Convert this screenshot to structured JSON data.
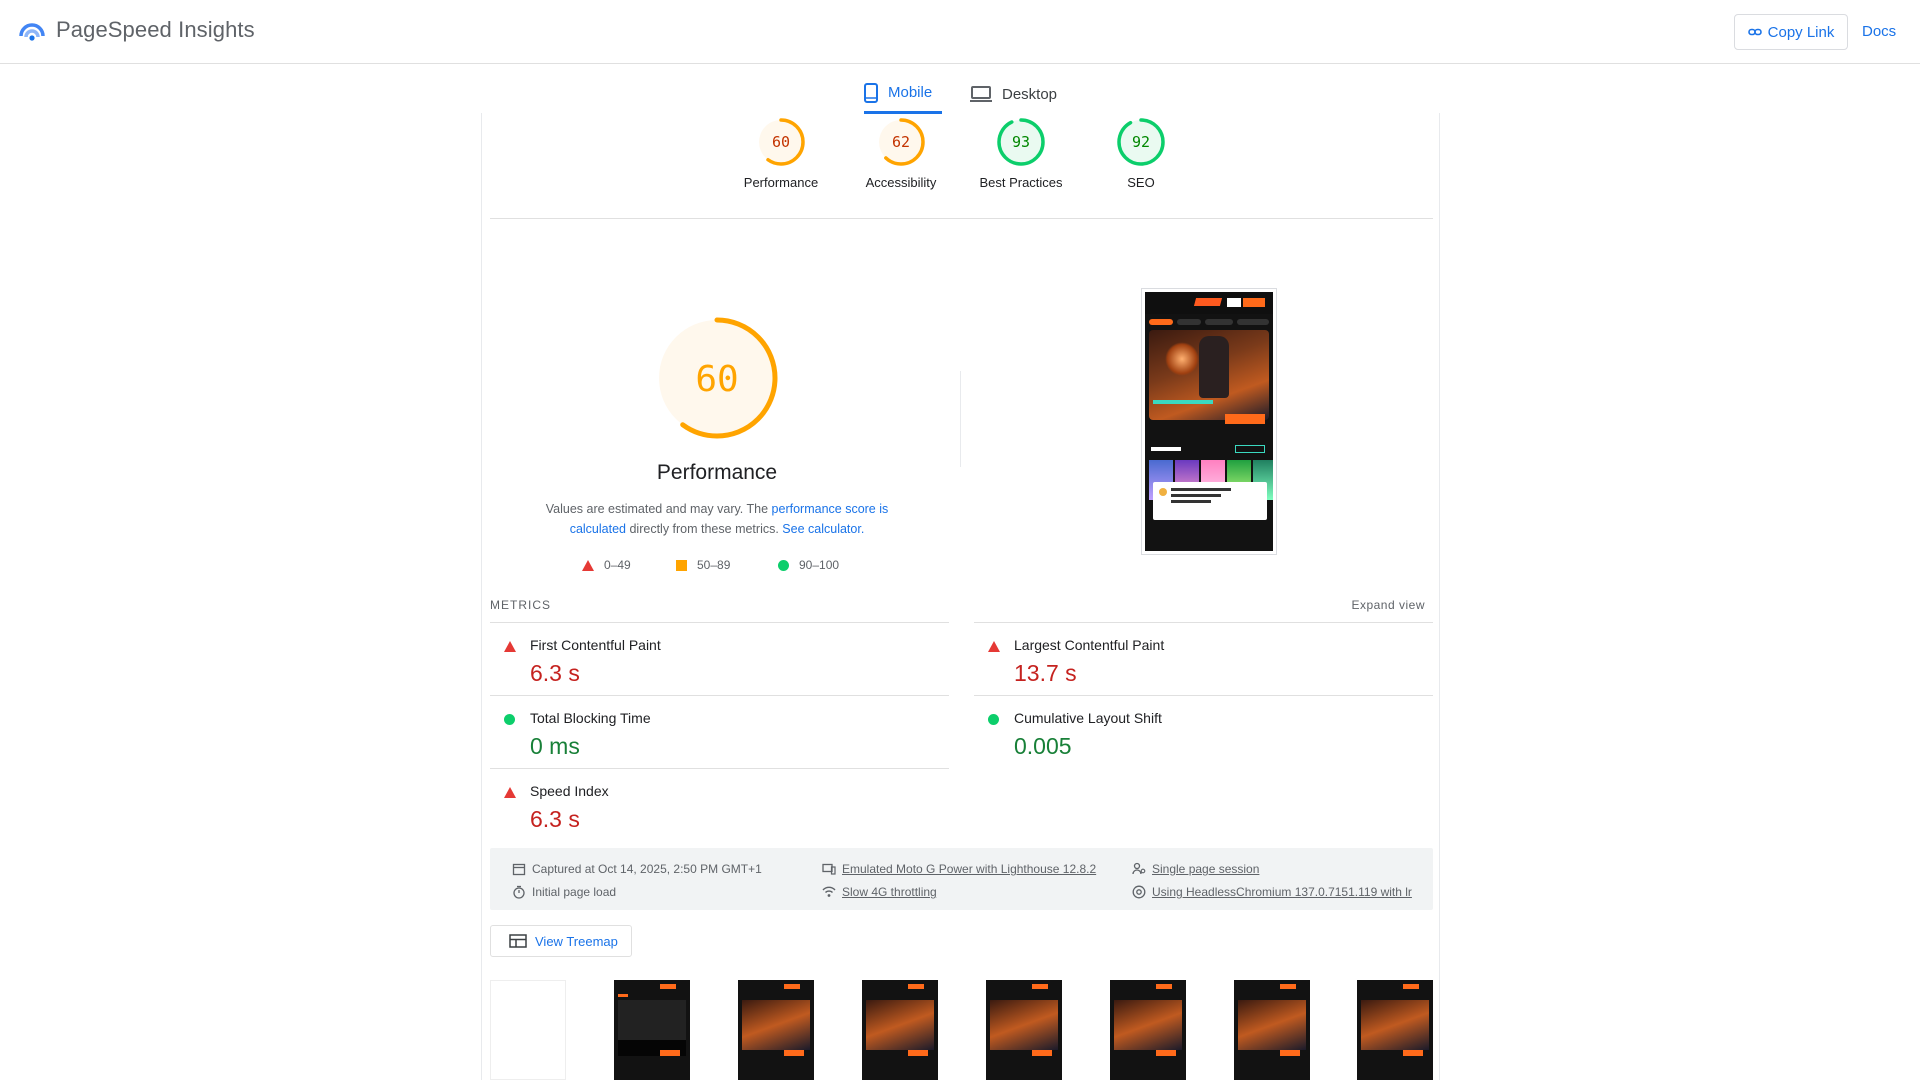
{
  "app": {
    "title": "PageSpeed Insights",
    "copy_link": "Copy Link",
    "docs": "Docs"
  },
  "tabs": [
    {
      "label": "Mobile",
      "selected": true
    },
    {
      "label": "Desktop",
      "selected": false
    }
  ],
  "categories": [
    {
      "score": "60",
      "label": "Performance",
      "status": "average"
    },
    {
      "score": "62",
      "label": "Accessibility",
      "status": "average"
    },
    {
      "score": "93",
      "label": "Best Practices",
      "status": "pass"
    },
    {
      "score": "92",
      "label": "SEO",
      "status": "pass"
    }
  ],
  "performance": {
    "score": "60",
    "score_fraction": 0.6,
    "title": "Performance",
    "desc_prefix": "Values are estimated and may vary. The ",
    "desc_link1": "performance score is calculated",
    "desc_middle": " directly from these metrics. ",
    "desc_link2": "See calculator.",
    "legend": [
      "0–49",
      "50–89",
      "90–100"
    ]
  },
  "metrics": {
    "header": "METRICS",
    "expand": "Expand view",
    "items": [
      {
        "name": "First Contentful Paint",
        "value": "6.3 s",
        "status": "fail"
      },
      {
        "name": "Largest Contentful Paint",
        "value": "13.7 s",
        "status": "fail"
      },
      {
        "name": "Total Blocking Time",
        "value": "0 ms",
        "status": "pass"
      },
      {
        "name": "Cumulative Layout Shift",
        "value": "0.005",
        "status": "pass"
      },
      {
        "name": "Speed Index",
        "value": "6.3 s",
        "status": "fail"
      }
    ]
  },
  "info": {
    "captured": "Captured at Oct 14, 2025, 2:50 PM GMT+1",
    "initial_load": "Initial page load",
    "device": "Emulated Moto G Power with Lighthouse 12.8.2",
    "throttling": "Slow 4G throttling",
    "session": "Single page session",
    "browser": "Using HeadlessChromium 137.0.7151.119 with lr"
  },
  "treemap": "View Treemap",
  "colors": {
    "accent": "#1a73e8",
    "average": "#ffa400",
    "pass": "#0cce6b",
    "fail": "#e53935"
  }
}
